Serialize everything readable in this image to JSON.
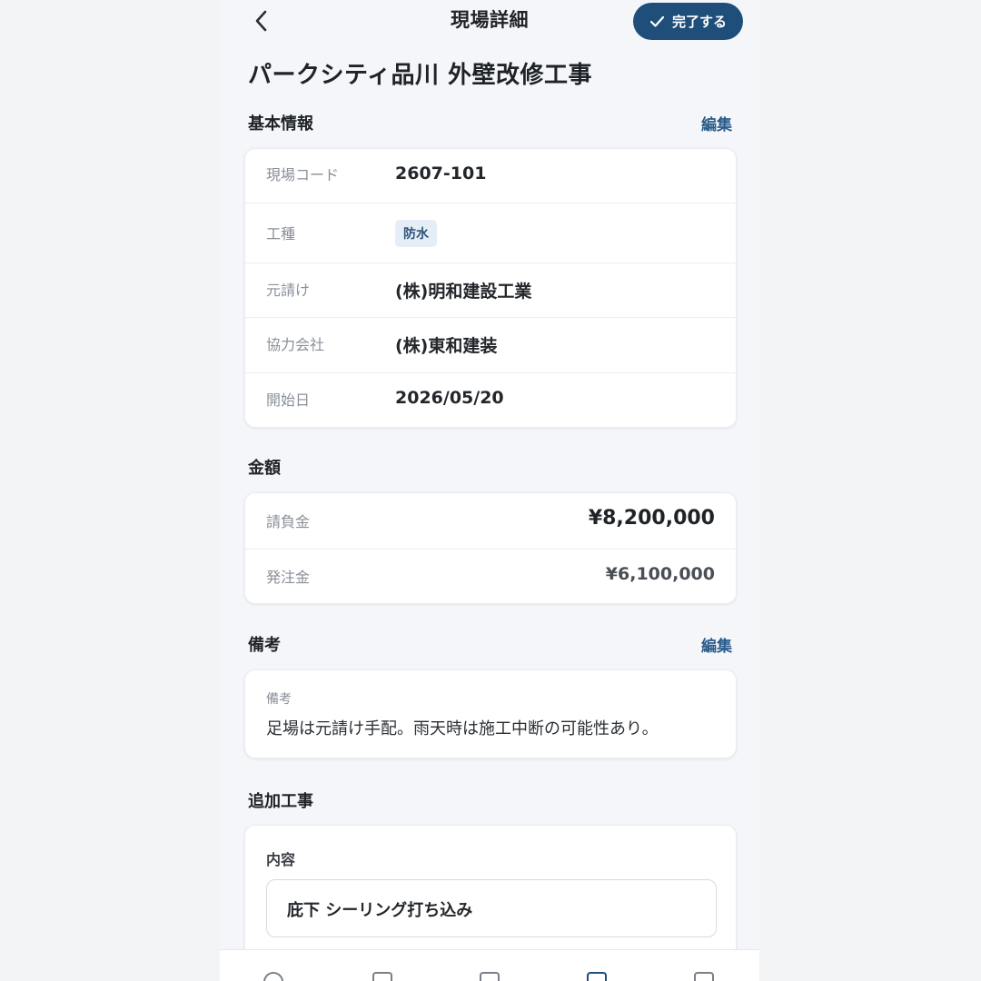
{
  "header": {
    "title": "現場詳細",
    "done_label": "完了する"
  },
  "page_title": "パークシティ品川 外壁改修工事",
  "basic_info": {
    "heading": "基本情報",
    "edit_label": "編集",
    "rows": [
      {
        "label": "現場コード",
        "value": "2607-101"
      },
      {
        "label": "工種",
        "value": "防水"
      },
      {
        "label": "元請け",
        "value": "(株)明和建設工業"
      },
      {
        "label": "協力会社",
        "value": "(株)東和建装"
      },
      {
        "label": "開始日",
        "value": "2026/05/20"
      }
    ]
  },
  "amounts": {
    "heading": "金額",
    "rows": [
      {
        "label": "請負金",
        "value": "¥8,200,000"
      },
      {
        "label": "発注金",
        "value": "¥6,100,000"
      }
    ]
  },
  "notes": {
    "heading": "備考",
    "edit_label": "編集",
    "label": "備考",
    "text": "足場は元請け手配。雨天時は施工中断の可能性あり。"
  },
  "additional_work": {
    "heading": "追加工事",
    "field_label": "内容",
    "field_value": "庇下 シーリング打ち込み"
  },
  "tabbar": {
    "items": [
      "home-icon",
      "save-icon",
      "calculator-icon",
      "hammer-icon",
      "settings-icon"
    ]
  }
}
